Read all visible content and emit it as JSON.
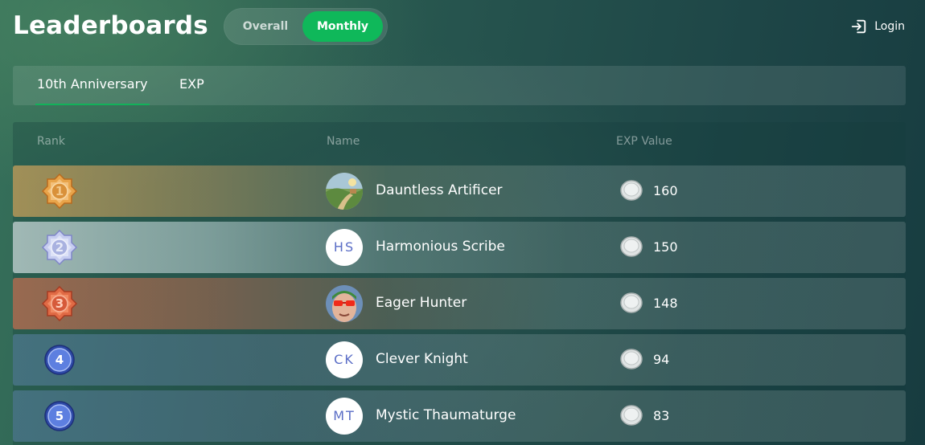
{
  "header": {
    "title": "Leaderboards",
    "toggle": {
      "overall": "Overall",
      "monthly": "Monthly",
      "selected": "Monthly"
    },
    "login": "Login"
  },
  "tabs": [
    {
      "label": "10th Anniversary",
      "active": true
    },
    {
      "label": "EXP",
      "active": false
    }
  ],
  "table": {
    "columns": {
      "rank": "Rank",
      "name": "Name",
      "exp": "EXP Value"
    },
    "rows": [
      {
        "rank": "1",
        "name": "Dauntless Artificer",
        "exp": "160",
        "avatar": "landscape-image",
        "badge": "gold"
      },
      {
        "rank": "2",
        "name": "Harmonious Scribe",
        "exp": "150",
        "avatar": "HS",
        "badge": "silver"
      },
      {
        "rank": "3",
        "name": "Eager Hunter",
        "exp": "148",
        "avatar": "face-image",
        "badge": "bronze"
      },
      {
        "rank": "4",
        "name": "Clever Knight",
        "exp": "94",
        "avatar": "CK",
        "badge": "blue"
      },
      {
        "rank": "5",
        "name": "Mystic Thaumaturge",
        "exp": "83",
        "avatar": "MT",
        "badge": "blue"
      }
    ]
  },
  "colors": {
    "accent": "#0fb85a",
    "gold": "#d9913a",
    "silver": "#a9b2e0",
    "bronze": "#d65a3a",
    "blue": "#3f5fc6",
    "initials": "#5a6dc6"
  }
}
